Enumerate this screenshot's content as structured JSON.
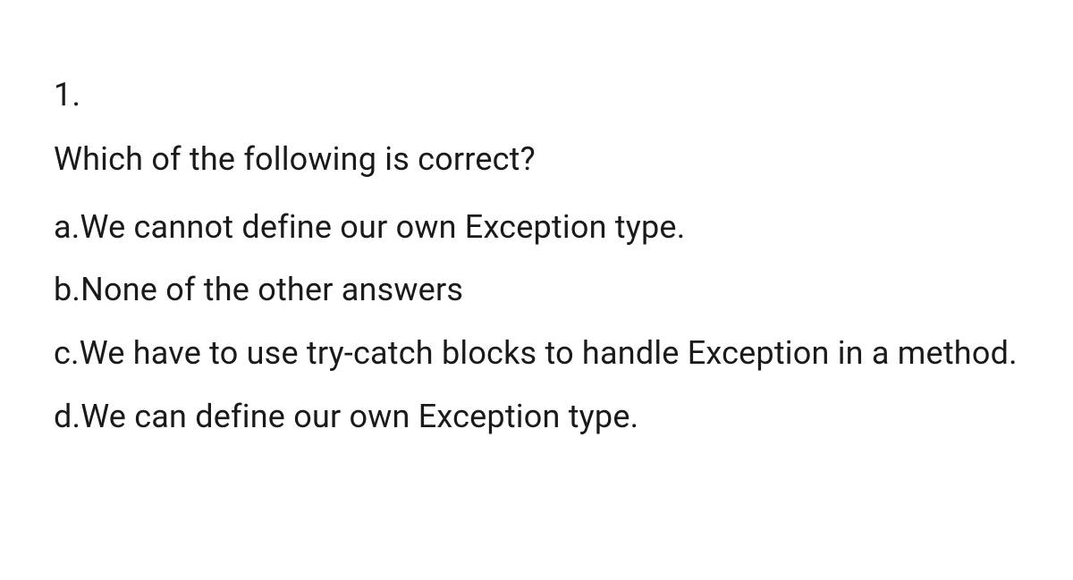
{
  "question": {
    "number": "1.",
    "text": "Which of the following is correct?",
    "options": [
      {
        "label": "a.",
        "text": "We cannot define our own Exception type."
      },
      {
        "label": "b.",
        "text": "None of the other answers"
      },
      {
        "label": "c.",
        "text": "We have to use try-catch blocks to handle Exception in a method."
      },
      {
        "label": "d.",
        "text": "We can define our own Exception type."
      }
    ]
  }
}
